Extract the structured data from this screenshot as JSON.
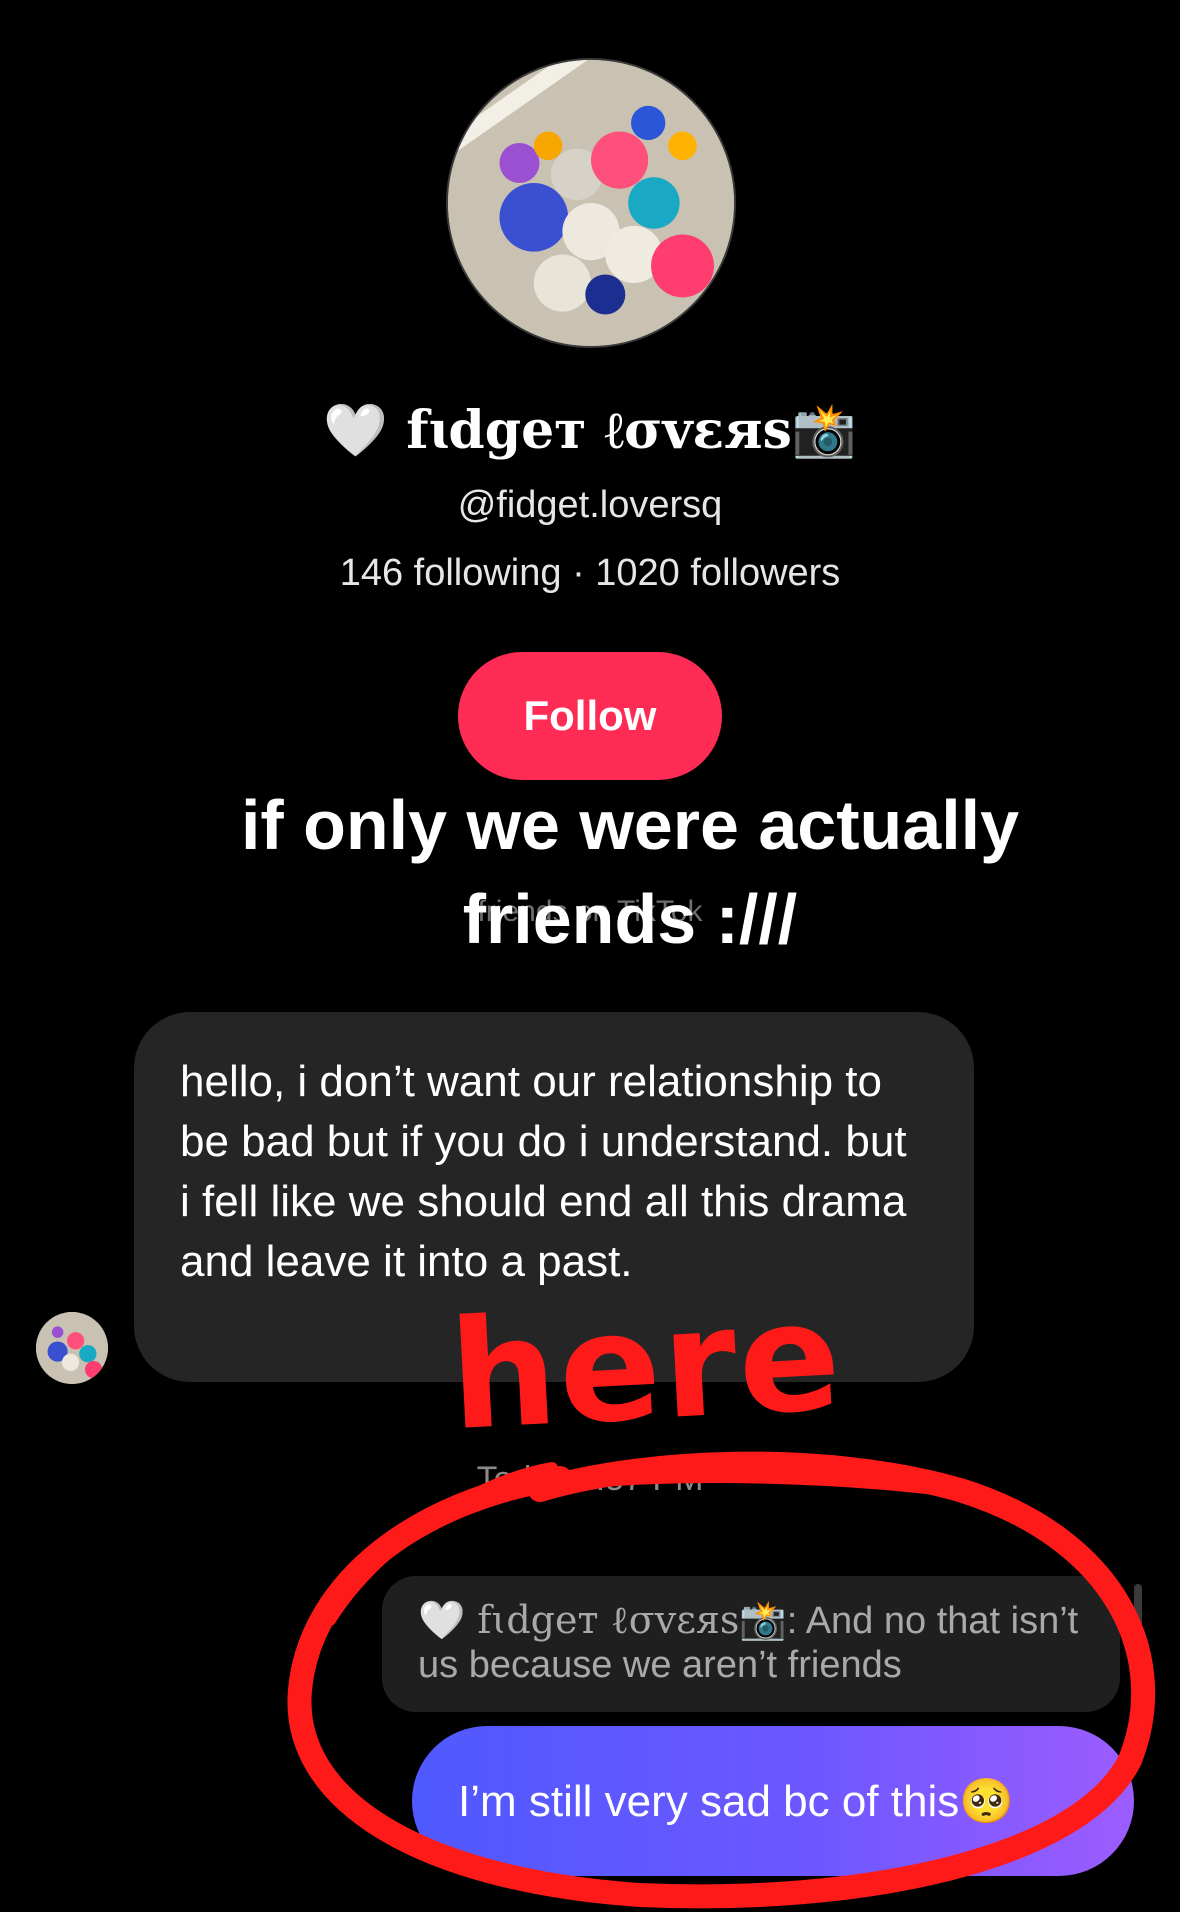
{
  "profile": {
    "display_name": "fɩdgeт ℓσvεяs",
    "display_name_heart": "🤍",
    "display_name_suffix": "📸",
    "handle": "@fidget.loversq",
    "stats": "146 following · 1020 followers",
    "follow_label": "Follow"
  },
  "caption": {
    "overlay_text": "if only we were actually friends :///",
    "faint_text": "friends on TikTok"
  },
  "messages": {
    "incoming_text": "hello, i don’t want our relationship to be bad but if you do i understand. but i fell like we should end all this drama and leave it into a past.",
    "timestamp": "Today 4:57 PM",
    "reply_quote_name": "🤍 fɩdgeт ℓσvεяs📸",
    "reply_quote_text": ": And no that isn’t us because we aren’t friends",
    "outgoing_text": "I’m still very sad bc of this🥺"
  },
  "annotation": {
    "scribble_text": "here",
    "color": "#ff1a1a"
  },
  "colors": {
    "background": "#000000",
    "follow_button": "#fe2c55",
    "incoming_bubble": "#252525",
    "outgoing_gradient_start": "#4f59ff",
    "outgoing_gradient_end": "#9c5cff"
  }
}
